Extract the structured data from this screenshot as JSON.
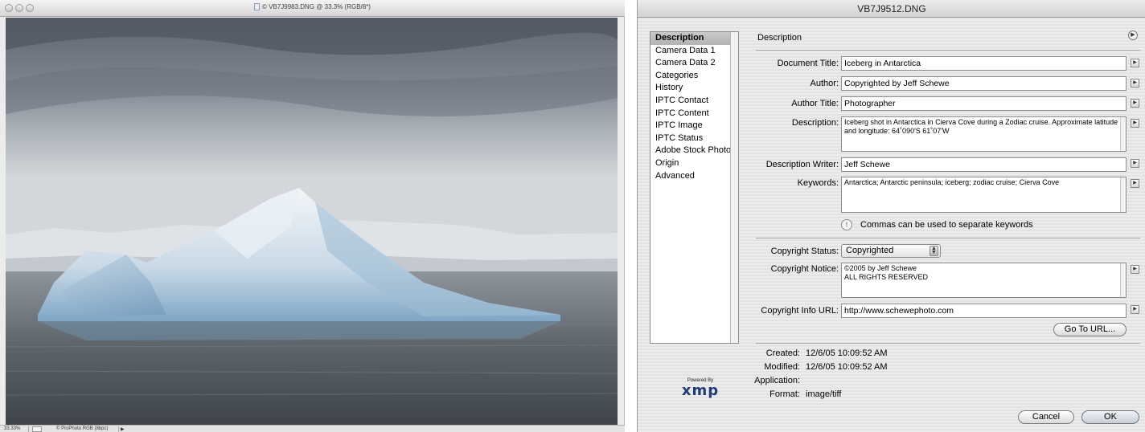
{
  "image_window": {
    "title": "© VB7J9983.DNG @ 33.3% (RGB/8*)",
    "status": {
      "zoom": "33.33%",
      "profile": "© ProPhoto RGB (8bpc)"
    }
  },
  "dialog": {
    "title": "VB7J9512.DNG",
    "categories": [
      "Description",
      "Camera Data 1",
      "Camera Data 2",
      "Categories",
      "History",
      "IPTC Contact",
      "IPTC Content",
      "IPTC Image",
      "IPTC Status",
      "Adobe Stock Photos",
      "Origin",
      "Advanced"
    ],
    "selected_category": "Description",
    "panel_title": "Description",
    "fields": {
      "document_title": {
        "label": "Document Title:",
        "value": "Iceberg in Antarctica"
      },
      "author": {
        "label": "Author:",
        "value": "Copyrighted by Jeff Schewe"
      },
      "author_title": {
        "label": "Author Title:",
        "value": "Photographer"
      },
      "description": {
        "label": "Description:",
        "value": "Iceberg shot in Antarctica in Cierva Cove during a Zodiac cruise. Approximate latitude and longitude:  64˚090'S 61˚07'W"
      },
      "description_writer": {
        "label": "Description Writer:",
        "value": "Jeff Schewe"
      },
      "keywords": {
        "label": "Keywords:",
        "value": "Antarctica; Antarctic peninsula; iceberg; zodiac cruise; Cierva Cove"
      },
      "copyright_status": {
        "label": "Copyright Status:",
        "value": "Copyrighted"
      },
      "copyright_notice": {
        "label": "Copyright Notice:",
        "value_line1": "©2005 by Jeff Schewe",
        "value_line2": "ALL RIGHTS RESERVED"
      },
      "copyright_url": {
        "label": "Copyright Info URL:",
        "value": "http://www.schewephoto.com"
      }
    },
    "keywords_hint": "Commas can be used to separate keywords",
    "buttons": {
      "goto_url": "Go To URL...",
      "cancel": "Cancel",
      "ok": "OK"
    },
    "metadata": {
      "created_label": "Created:",
      "created": "12/6/05 10:09:52 AM",
      "modified_label": "Modified:",
      "modified": "12/6/05 10:09:52 AM",
      "application_label": "Application:",
      "application": "",
      "format_label": "Format:",
      "format": "image/tiff"
    },
    "xmp_logo": {
      "powered_by": "Powered By",
      "word": "xmp"
    }
  },
  "colors": {
    "accent_ok": "#c9ced6",
    "list_selection": "#b3b3b3"
  }
}
